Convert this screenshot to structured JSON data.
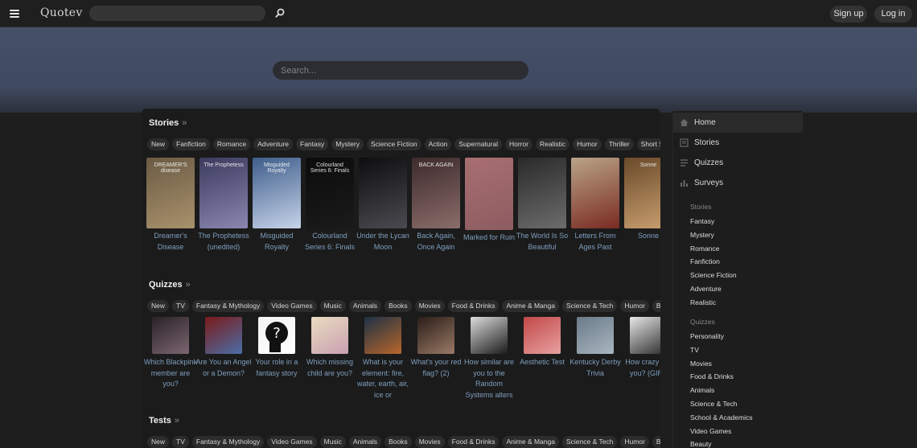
{
  "header": {
    "logo": "Quotev",
    "signup_label": "Sign up",
    "login_label": "Log in"
  },
  "hero": {
    "search_placeholder": "Search..."
  },
  "stories": {
    "title": "Stories",
    "chips": [
      "New",
      "Fanfiction",
      "Romance",
      "Adventure",
      "Fantasy",
      "Mystery",
      "Science Fiction",
      "Action",
      "Supernatural",
      "Horror",
      "Realistic",
      "Humor",
      "Thriller",
      "Short Stories"
    ],
    "cards": [
      {
        "title": "Dreamer's Disease",
        "cover_text": "DREAMER'S disease",
        "c1": "#6b5a44",
        "c2": "#a8926c"
      },
      {
        "title": "The Prophetess (unedited)",
        "cover_text": "The Prophetess",
        "c1": "#3b3a5e",
        "c2": "#8a86b0"
      },
      {
        "title": "Misguided Royalty",
        "cover_text": "Misguided Royalty",
        "c1": "#3e5d8a",
        "c2": "#c7d4ea"
      },
      {
        "title": "Colourland Series 6: Finals",
        "cover_text": "Colourland Series 6: Finals",
        "c1": "#0c0c0c",
        "c2": "#1a1a1a"
      },
      {
        "title": "Under the Lycan Moon",
        "cover_text": "",
        "c1": "#0e0e10",
        "c2": "#4a4a50"
      },
      {
        "title": "Back Again, Once Again",
        "cover_text": "BACK AGAIN",
        "c1": "#3d2a2c",
        "c2": "#8a6d6a"
      },
      {
        "title": "Marked for Ruin",
        "cover_text": "",
        "c1": "#a86f72",
        "c2": "#8d5c60"
      },
      {
        "title": "The World Is So Beautiful",
        "cover_text": "",
        "c1": "#2a2a2a",
        "c2": "#6c6c6c"
      },
      {
        "title": "Letters From Ages Past",
        "cover_text": "",
        "c1": "#b9a488",
        "c2": "#7a2a22"
      },
      {
        "title": "Sonne",
        "cover_text": "Sonne",
        "c1": "#6a4a2a",
        "c2": "#caa070"
      }
    ]
  },
  "quizzes": {
    "title": "Quizzes",
    "chips": [
      "New",
      "TV",
      "Fantasy & Mythology",
      "Video Games",
      "Music",
      "Animals",
      "Books",
      "Movies",
      "Food & Drinks",
      "Anime & Manga",
      "Science & Tech",
      "Humor",
      "Beauty"
    ],
    "cards": [
      {
        "title": "Which Blackpink member are you?",
        "c1": "#2a2228",
        "c2": "#7c6670"
      },
      {
        "title": "Are You an Angel or a Demon?",
        "c1": "#7a1a18",
        "c2": "#4b6ea8"
      },
      {
        "title": "Your role in a fantasy story",
        "c1": "#f2f2f2",
        "c2": "#ffffff"
      },
      {
        "title": "Which missing child are you?",
        "c1": "#e9dcc0",
        "c2": "#c9a0b0"
      },
      {
        "title": "What is your element: fire, water, earth, air, ice or",
        "c1": "#1e3146",
        "c2": "#b8662a"
      },
      {
        "title": "What's your red flag? (2)",
        "c1": "#2a1d18",
        "c2": "#9a7a66"
      },
      {
        "title": "How similar are you to the Random Systems alters",
        "c1": "#dcdcdc",
        "c2": "#1a1a1a"
      },
      {
        "title": "Aesthetic Test",
        "c1": "#c24848",
        "c2": "#e8a0a0"
      },
      {
        "title": "Kentucky Derby Trivia",
        "c1": "#6a7a88",
        "c2": "#a8b6c0"
      },
      {
        "title": "How crazy are you? (GIRL",
        "c1": "#e8e8e8",
        "c2": "#2a2a2a"
      }
    ]
  },
  "tests": {
    "title": "Tests",
    "chips": [
      "New",
      "TV",
      "Fantasy & Mythology",
      "Video Games",
      "Music",
      "Animals",
      "Books",
      "Movies",
      "Food & Drinks",
      "Anime & Manga",
      "Science & Tech",
      "Humor",
      "Beauty"
    ]
  },
  "sidebar": {
    "main": [
      {
        "label": "Home",
        "icon": "home-icon"
      },
      {
        "label": "Stories",
        "icon": "stories-icon"
      },
      {
        "label": "Quizzes",
        "icon": "quizzes-icon"
      },
      {
        "label": "Surveys",
        "icon": "surveys-icon"
      }
    ],
    "stories_head": "Stories",
    "stories_links": [
      "Fantasy",
      "Mystery",
      "Romance",
      "Fanfiction",
      "Science Fiction",
      "Adventure",
      "Realistic"
    ],
    "quizzes_head": "Quizzes",
    "quizzes_links": [
      "Personality",
      "TV",
      "Movies",
      "Food & Drinks",
      "Animals",
      "Science & Tech",
      "School & Academics",
      "Video Games",
      "Beauty"
    ]
  }
}
